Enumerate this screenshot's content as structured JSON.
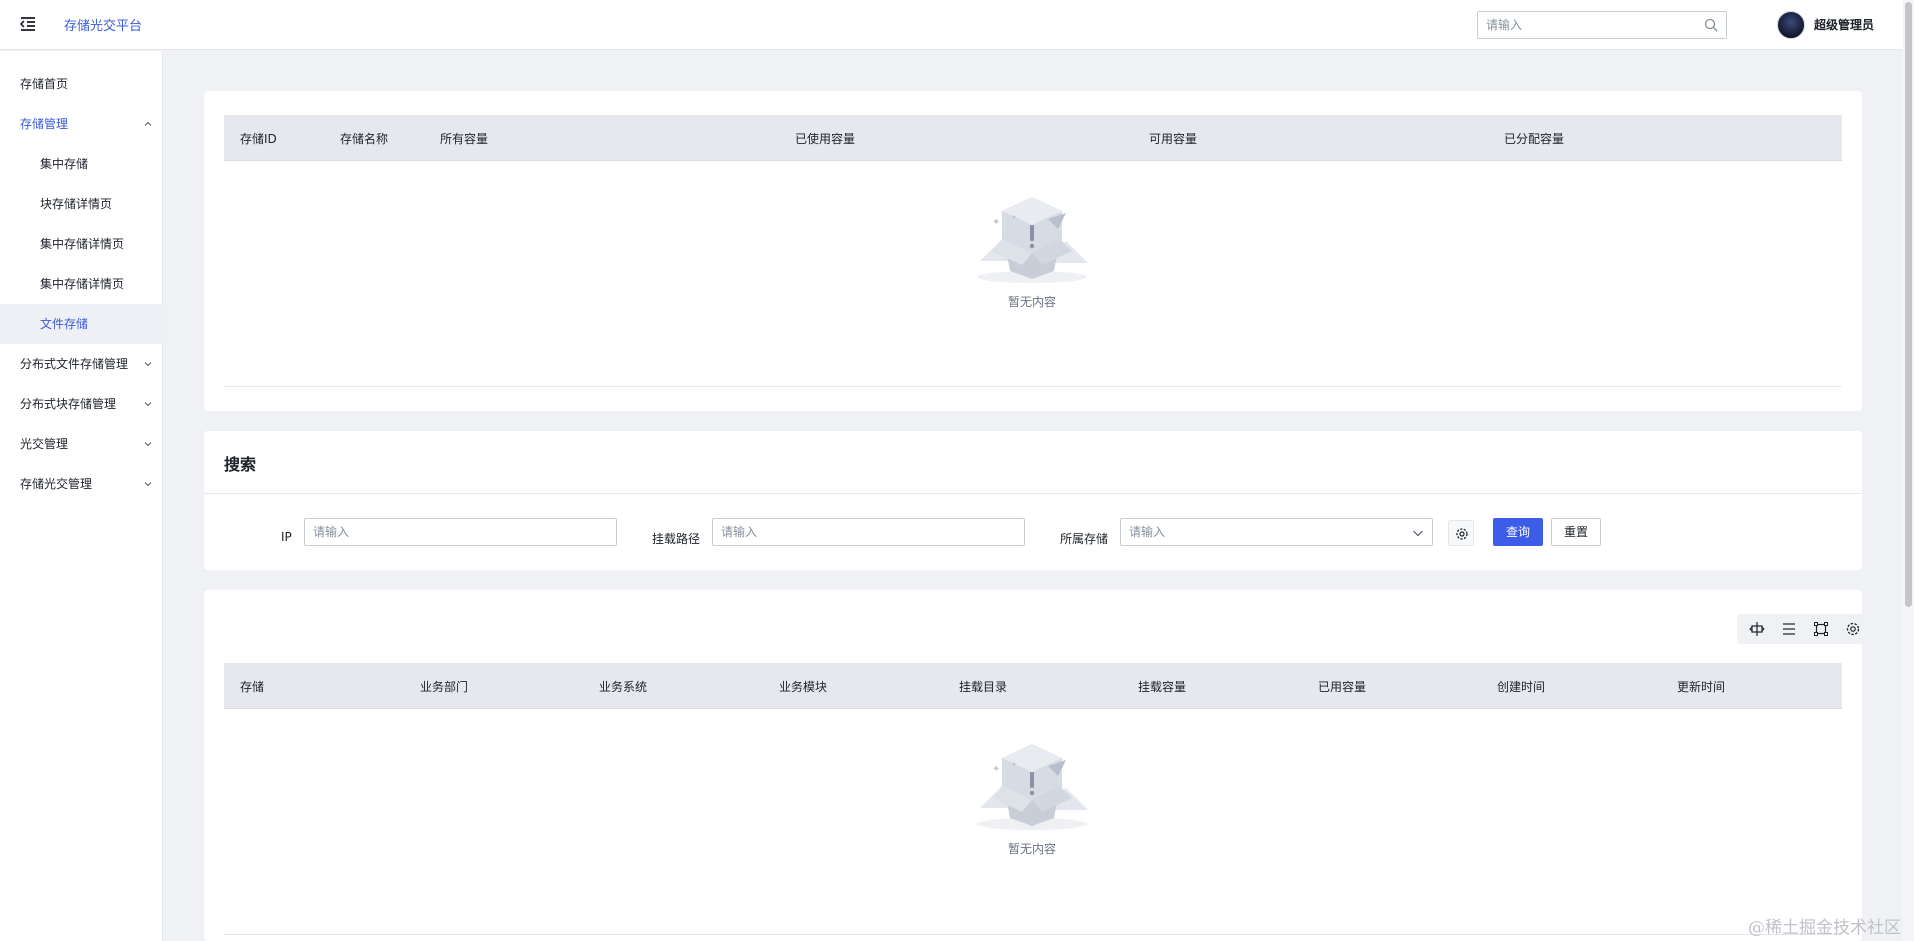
{
  "header": {
    "title": "存储光交平台",
    "search_placeholder": "请输入",
    "user_name": "超级管理员"
  },
  "sidebar": {
    "items": [
      {
        "label": "存储首页"
      },
      {
        "label": "存储管理"
      },
      {
        "label": "集中存储"
      },
      {
        "label": "块存储详情页"
      },
      {
        "label": "集中存储详情页"
      },
      {
        "label": "集中存储详情页"
      },
      {
        "label": "文件存储"
      },
      {
        "label": "分布式文件存储管理"
      },
      {
        "label": "分布式块存储管理"
      },
      {
        "label": "光交管理"
      },
      {
        "label": "存储光交管理"
      }
    ]
  },
  "storage_table": {
    "columns": [
      "存储ID",
      "存储名称",
      "所有容量",
      "已使用容量",
      "可用容量",
      "已分配容量"
    ],
    "empty_text": "暂无内容"
  },
  "search": {
    "title": "搜索",
    "ip_label": "IP",
    "ip_placeholder": "请输入",
    "path_label": "挂载路径",
    "path_placeholder": "请输入",
    "storage_label": "所属存储",
    "storage_placeholder": "请输入",
    "query_button": "查询",
    "reset_button": "重置"
  },
  "mount_table": {
    "columns": [
      "存储",
      "业务部门",
      "业务系统",
      "业务模块",
      "挂载目录",
      "挂载容量",
      "已用容量",
      "创建时间",
      "更新时间"
    ],
    "empty_text": "暂无内容"
  },
  "watermark": "@稀土掘金技术社区",
  "colors": {
    "accent": "#3d5ce8",
    "link": "#3a5bd9",
    "page_bg": "#f0f1f5",
    "table_header_bg": "#e7e8ed"
  }
}
